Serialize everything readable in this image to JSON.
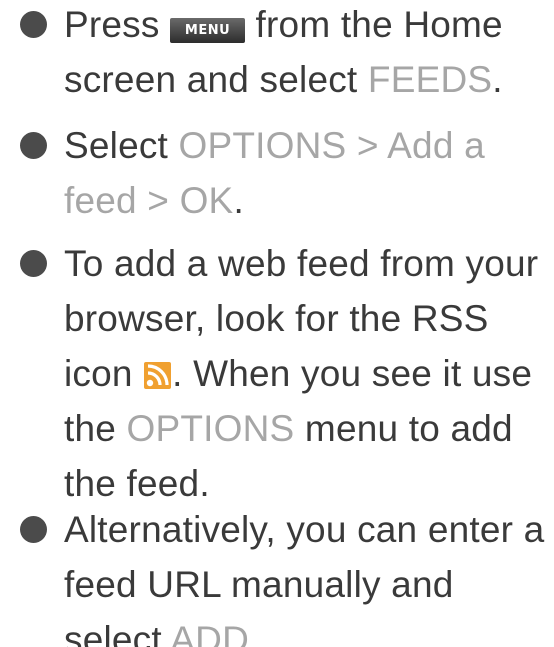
{
  "items": [
    {
      "pre": "Press ",
      "menu_key": "MENU",
      "mid": " from the Home screen and select ",
      "feeds": "FEEDS",
      "end": "."
    },
    {
      "pre": "Select ",
      "options": "OPTIONS > Add a feed > OK",
      "end": "."
    },
    {
      "pre": "To add a web feed from your browser, look for the RSS icon ",
      "icon": "rss-icon",
      "mid": ". When you see it use the ",
      "options": "OPTIONS",
      "end": " menu to add the feed."
    },
    {
      "pre": "Alternatively, you can enter a feed URL manually and select ",
      "add": "ADD",
      "end": "."
    }
  ],
  "colors": {
    "text": "#3a3a3a",
    "highlight": "#a6a6a6",
    "bullet": "#4b4b4b",
    "rss": "#f0a030"
  }
}
